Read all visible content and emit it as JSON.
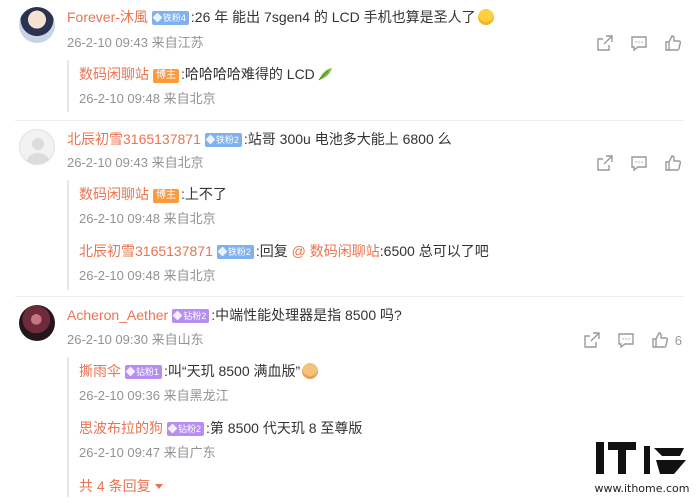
{
  "comments": [
    {
      "user": "Forever-沐風",
      "badge": "铁粉4",
      "text": ":26 年 能出 7sgen4 的 LCD 手机也算是圣人了",
      "emoji": "wow-emoji",
      "date": "26-2-10 09:43 来自江苏",
      "replies": [
        {
          "user": "数码闲聊站",
          "badge": "博主",
          "text": ":哈哈哈哈难得的 LCD",
          "emoji": "leaf-emoji",
          "date": "26-2-10 09:48 来自北京"
        }
      ]
    },
    {
      "user": "北辰初雪3165137871",
      "badge": "铁粉2",
      "text": ":站哥 300u 电池多大能上 6800 么",
      "date": "26-2-10 09:43 来自北京",
      "replies": [
        {
          "user": "数码闲聊站",
          "badge": "博主",
          "text": ":上不了",
          "date": "26-2-10 09:48 来自北京"
        },
        {
          "user": "北辰初雪3165137871",
          "badge": "铁粉2",
          "text_prefix": ":回复 ",
          "mention": "@ 数码闲聊站",
          "text": ":6500 总可以了吧",
          "date": "26-2-10 09:48 来自北京"
        }
      ]
    },
    {
      "user": "Acheron_Aether",
      "badge": "钻粉2",
      "text": ":中端性能处理器是指 8500 吗?",
      "date": "26-2-10 09:30 来自山东",
      "like_count": "6",
      "replies": [
        {
          "user": "撕雨伞",
          "badge": "钻粉1",
          "text": ":叫“天玑 8500 满血版”",
          "emoji": "dog-emoji",
          "date": "26-2-10 09:36 来自黑龙江"
        },
        {
          "user": "思波布拉的狗",
          "badge": "钻粉2",
          "text": ":第 8500 代天玑 8 至尊版",
          "date": "26-2-10 09:47 来自广东"
        }
      ],
      "more_replies": "共 4 条回复"
    }
  ],
  "watermark": {
    "logo": "IT之家",
    "url": "www.ithome.com"
  },
  "colors": {
    "name": "#eb7350",
    "text": "#333333",
    "meta": "#939393",
    "badge_blue": "#7fb0f0",
    "badge_purple": "#b68ef2",
    "badge_bozhu": "#ff9a3c"
  }
}
